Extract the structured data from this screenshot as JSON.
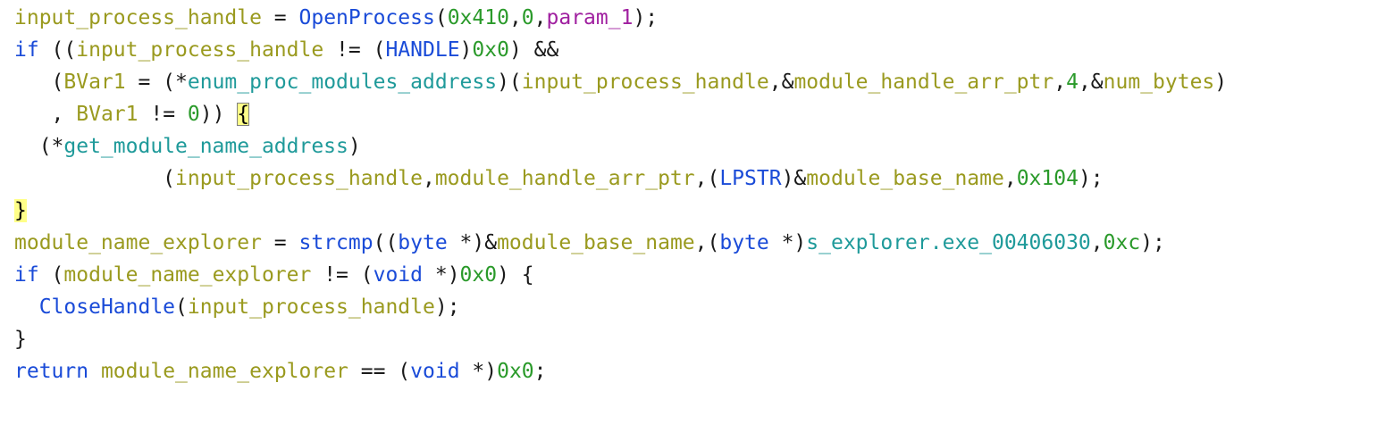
{
  "code_view": {
    "lines": [
      [
        {
          "t": "input_process_handle",
          "k": "var"
        },
        {
          "t": " = ",
          "k": "plain"
        },
        {
          "t": "OpenProcess",
          "k": "func"
        },
        {
          "t": "(",
          "k": "plain"
        },
        {
          "t": "0x410",
          "k": "num"
        },
        {
          "t": ",",
          "k": "plain"
        },
        {
          "t": "0",
          "k": "num"
        },
        {
          "t": ",",
          "k": "plain"
        },
        {
          "t": "param_1",
          "k": "param"
        },
        {
          "t": ");",
          "k": "plain"
        }
      ],
      [
        {
          "t": "if",
          "k": "keyword"
        },
        {
          "t": " ((",
          "k": "plain"
        },
        {
          "t": "input_process_handle",
          "k": "var"
        },
        {
          "t": " != (",
          "k": "plain"
        },
        {
          "t": "HANDLE",
          "k": "type"
        },
        {
          "t": ")",
          "k": "plain"
        },
        {
          "t": "0x0",
          "k": "num"
        },
        {
          "t": ") &&",
          "k": "plain"
        }
      ],
      [
        {
          "t": "   (",
          "k": "plain"
        },
        {
          "t": "BVar1",
          "k": "var"
        },
        {
          "t": " = (*",
          "k": "plain"
        },
        {
          "t": "enum_proc_modules_address",
          "k": "funcptr"
        },
        {
          "t": ")(",
          "k": "plain"
        },
        {
          "t": "input_process_handle",
          "k": "var"
        },
        {
          "t": ",&",
          "k": "plain"
        },
        {
          "t": "module_handle_arr_ptr",
          "k": "var"
        },
        {
          "t": ",",
          "k": "plain"
        },
        {
          "t": "4",
          "k": "num"
        },
        {
          "t": ",&",
          "k": "plain"
        },
        {
          "t": "num_bytes",
          "k": "var"
        },
        {
          "t": ")",
          "k": "plain"
        }
      ],
      [
        {
          "t": "   , ",
          "k": "plain"
        },
        {
          "t": "BVar1",
          "k": "var"
        },
        {
          "t": " != ",
          "k": "plain"
        },
        {
          "t": "0",
          "k": "num"
        },
        {
          "t": ")) ",
          "k": "plain"
        },
        {
          "t": "{",
          "k": "brace-box"
        }
      ],
      [
        {
          "t": "  (*",
          "k": "plain"
        },
        {
          "t": "get_module_name_address",
          "k": "funcptr"
        },
        {
          "t": ")",
          "k": "plain"
        }
      ],
      [
        {
          "t": "            (",
          "k": "plain"
        },
        {
          "t": "input_process_handle",
          "k": "var"
        },
        {
          "t": ",",
          "k": "plain"
        },
        {
          "t": "module_handle_arr_ptr",
          "k": "var"
        },
        {
          "t": ",(",
          "k": "plain"
        },
        {
          "t": "LPSTR",
          "k": "type"
        },
        {
          "t": ")&",
          "k": "plain"
        },
        {
          "t": "module_base_name",
          "k": "var"
        },
        {
          "t": ",",
          "k": "plain"
        },
        {
          "t": "0x104",
          "k": "num"
        },
        {
          "t": ");",
          "k": "plain"
        }
      ],
      [
        {
          "t": "}",
          "k": "brace-hl"
        }
      ],
      [
        {
          "t": "module_name_explorer",
          "k": "var"
        },
        {
          "t": " = ",
          "k": "plain"
        },
        {
          "t": "strcmp",
          "k": "func"
        },
        {
          "t": "((",
          "k": "plain"
        },
        {
          "t": "byte",
          "k": "type"
        },
        {
          "t": " *)&",
          "k": "plain"
        },
        {
          "t": "module_base_name",
          "k": "var"
        },
        {
          "t": ",(",
          "k": "plain"
        },
        {
          "t": "byte",
          "k": "type"
        },
        {
          "t": " *)",
          "k": "plain"
        },
        {
          "t": "s_explorer.exe_00406030",
          "k": "string"
        },
        {
          "t": ",",
          "k": "plain"
        },
        {
          "t": "0xc",
          "k": "num"
        },
        {
          "t": ");",
          "k": "plain"
        }
      ],
      [
        {
          "t": "if",
          "k": "keyword"
        },
        {
          "t": " (",
          "k": "plain"
        },
        {
          "t": "module_name_explorer",
          "k": "var"
        },
        {
          "t": " != (",
          "k": "plain"
        },
        {
          "t": "void",
          "k": "type"
        },
        {
          "t": " *)",
          "k": "plain"
        },
        {
          "t": "0x0",
          "k": "num"
        },
        {
          "t": ") {",
          "k": "plain"
        }
      ],
      [
        {
          "t": "  ",
          "k": "plain"
        },
        {
          "t": "CloseHandle",
          "k": "func"
        },
        {
          "t": "(",
          "k": "plain"
        },
        {
          "t": "input_process_handle",
          "k": "var"
        },
        {
          "t": ");",
          "k": "plain"
        }
      ],
      [
        {
          "t": "}",
          "k": "plain"
        }
      ],
      [
        {
          "t": "return",
          "k": "keyword"
        },
        {
          "t": " ",
          "k": "plain"
        },
        {
          "t": "module_name_explorer",
          "k": "var"
        },
        {
          "t": " == (",
          "k": "plain"
        },
        {
          "t": "void",
          "k": "type"
        },
        {
          "t": " *)",
          "k": "plain"
        },
        {
          "t": "0x0",
          "k": "num"
        },
        {
          "t": ";",
          "k": "plain"
        }
      ]
    ]
  }
}
